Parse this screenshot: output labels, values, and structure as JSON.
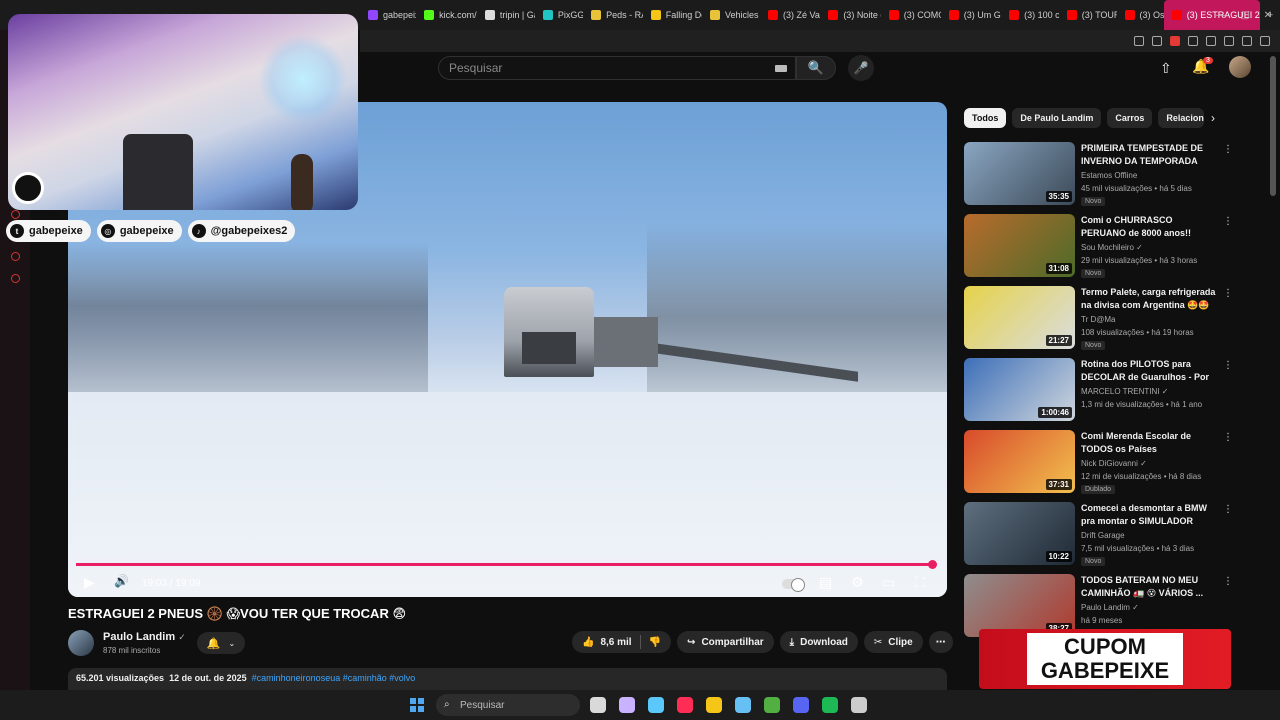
{
  "browser": {
    "tabs": [
      {
        "label": "gabepeix",
        "color": "#9146ff"
      },
      {
        "label": "kick.com/g",
        "color": "#53fc18"
      },
      {
        "label": "tripin | Ga",
        "color": "#dddddd"
      },
      {
        "label": "PixGG",
        "color": "#22c3c3"
      },
      {
        "label": "Peds - RA",
        "color": "#e8c33a"
      },
      {
        "label": "Falling Do",
        "color": "#f5c518"
      },
      {
        "label": "Vehicles -",
        "color": "#e8c33a"
      },
      {
        "label": "(3) Zé Vaq",
        "color": "#ff0000"
      },
      {
        "label": "(3) Noite d",
        "color": "#ff0000"
      },
      {
        "label": "(3) COMO",
        "color": "#ff0000"
      },
      {
        "label": "(3) Um Ge",
        "color": "#ff0000"
      },
      {
        "label": "(3) 100 cr",
        "color": "#ff0000"
      },
      {
        "label": "(3) TOUR",
        "color": "#ff0000"
      },
      {
        "label": "(3) Os",
        "color": "#ff0000"
      }
    ],
    "active_tab": "(3) ESTRAGUEI 2 PN",
    "new_tab": "+",
    "window_controls": {
      "minimize": "—",
      "maximize": "▢",
      "close": "✕"
    }
  },
  "header": {
    "search_placeholder": "Pesquisar",
    "search_icon": "🔍",
    "mic_icon": "🎤",
    "upload_icon": "⇧",
    "bell_icon": "🔔",
    "notif_count": "3"
  },
  "overlay": {
    "socials": [
      {
        "icon": "t",
        "handle": "gabepeixe"
      },
      {
        "icon": "◎",
        "handle": "gabepeixe"
      },
      {
        "icon": "♪",
        "handle": "@gabepeixes2"
      }
    ]
  },
  "player": {
    "time": "19:03 / 19:09",
    "progress": 0.995,
    "play_icon": "▶",
    "volume_icon": "🔊",
    "subtitles_icon": "▤",
    "settings_icon": "⚙",
    "theater_icon": "▭",
    "fullscreen_icon": "⛶"
  },
  "video": {
    "title": "ESTRAGUEI 2 PNEUS 🛞 😱VOU TER QUE TROCAR 😨",
    "channel": "Paulo Landim",
    "verified": "✓",
    "subscribers": "878 mil inscritos",
    "likes": "8,6 mil",
    "share": "Compartilhar",
    "download": "Download",
    "clip": "Clipe",
    "views": "65.201 visualizações",
    "date": "12 de out. de 2025",
    "hashtags": "#caminhoneironoseua #caminhão #volvo"
  },
  "sidebar": {
    "chips": [
      "Todos",
      "De Paulo Landim",
      "Carros",
      "Relacion"
    ],
    "recommendations": [
      {
        "title": "PRIMEIRA TEMPESTADE DE INVERNO DA TEMPORADA",
        "channel": "Estamos Offline",
        "meta": "45 mil visualizações • há 5 dias",
        "badge": "Novo",
        "duration": "35:35",
        "c1": "#8aa6c2",
        "c2": "#3c4a58"
      },
      {
        "title": "Comi o CHURRASCO PERUANO de 8000 anos!! (comida Inca ...",
        "channel": "Sou Mochileiro ✓",
        "meta": "29 mil visualizações • há 3 horas",
        "badge": "Novo",
        "duration": "31:08",
        "c1": "#b86b2c",
        "c2": "#4d6b2a"
      },
      {
        "title": "Termo Palete, carga refrigerada na divisa com Argentina 🤩🤩",
        "channel": "Tr D@Ma",
        "meta": "108 visualizações • há 19 horas",
        "badge": "Novo",
        "duration": "21:27",
        "c1": "#e6d24a",
        "c2": "#d9dde0"
      },
      {
        "title": "Rotina dos PILOTOS para DECOLAR de Guarulhos - Por ...",
        "channel": "MARCELO TRENTINI ✓",
        "meta": "1,3 mi de visualizações • há 1 ano",
        "badge": "",
        "duration": "1:00:46",
        "c1": "#3d6fb8",
        "c2": "#cfd6dd"
      },
      {
        "title": "Comi Merenda Escolar de TODOS os Países",
        "channel": "Nick DiGiovanni ✓",
        "meta": "12 mi de visualizações • há 8 dias",
        "badge": "Dublado",
        "duration": "37:31",
        "c1": "#d84a2b",
        "c2": "#f2c14e"
      },
      {
        "title": "Comecei a desmontar a BMW pra montar o SIMULADOR",
        "channel": "Drift Garage",
        "meta": "7,5 mil visualizações • há 3 dias",
        "badge": "Novo",
        "duration": "10:22",
        "c1": "#5e6f7f",
        "c2": "#1f2a35"
      },
      {
        "title": "TODOS BATERAM NO MEU CAMINHÃO 🚛 😵 VÁRIOS ...",
        "channel": "Paulo Landim ✓",
        "meta": "há 9 meses",
        "badge": "",
        "duration": "38:27",
        "c1": "#8e8e8e",
        "c2": "#b03a2e"
      }
    ]
  },
  "banner": {
    "line1": "CUPOM",
    "line2": "GABEPEIXE"
  },
  "taskbar": {
    "search_placeholder": "Pesquisar",
    "icons": [
      {
        "name": "files-icon",
        "color": "#d9d9d9"
      },
      {
        "name": "app-icon",
        "color": "#c9b2ff"
      },
      {
        "name": "copilot-icon",
        "color": "#5ac8fa"
      },
      {
        "name": "opera-icon",
        "color": "#ff2d55"
      },
      {
        "name": "explorer-icon",
        "color": "#f5c518"
      },
      {
        "name": "steam-icon",
        "color": "#66c0f4"
      },
      {
        "name": "xbox-icon",
        "color": "#52b043"
      },
      {
        "name": "discord-icon",
        "color": "#5865f2"
      },
      {
        "name": "spotify-icon",
        "color": "#1db954"
      },
      {
        "name": "obs-icon",
        "color": "#cccccc"
      }
    ]
  }
}
